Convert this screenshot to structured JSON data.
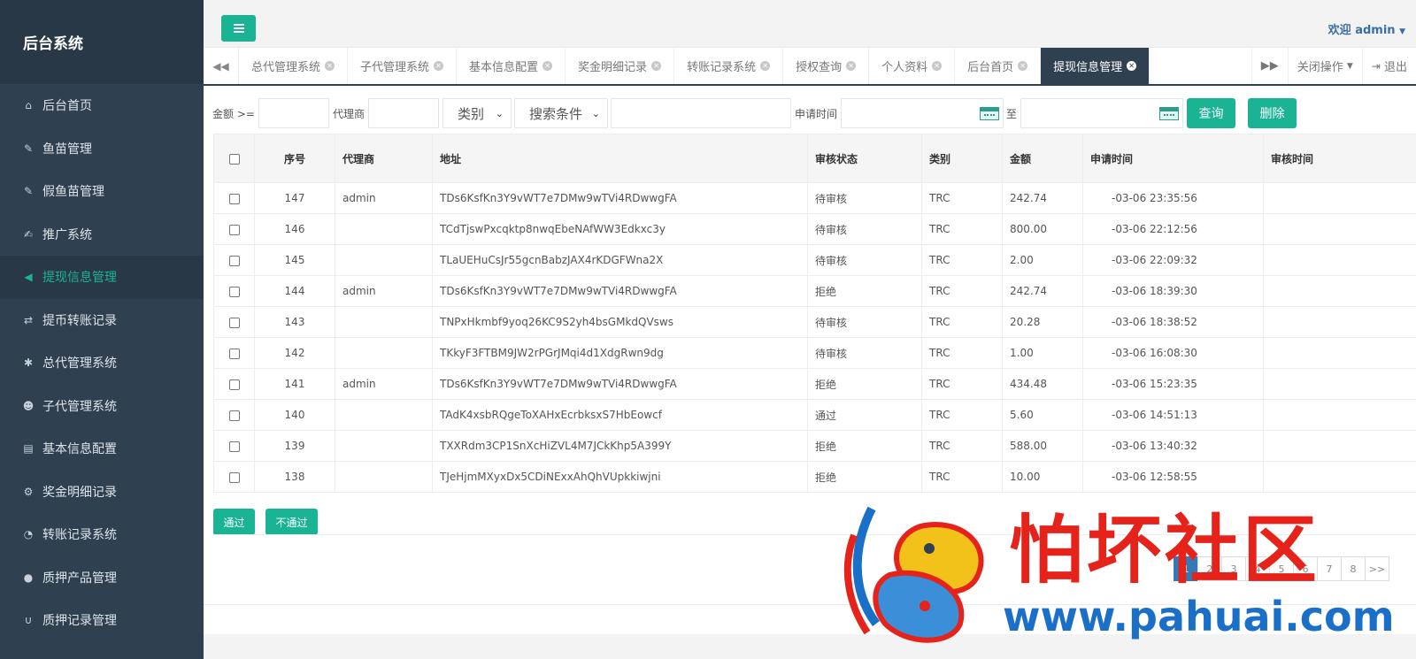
{
  "sidebar": {
    "brand": "后台系统",
    "items": [
      {
        "label": "后台首页",
        "icon": "home-icon",
        "glyph": "⌂",
        "active": false
      },
      {
        "label": "鱼苗管理",
        "icon": "wrench-icon",
        "glyph": "✎",
        "active": false
      },
      {
        "label": "假鱼苗管理",
        "icon": "wrench-icon",
        "glyph": "✎",
        "active": false
      },
      {
        "label": "推广系统",
        "icon": "edit-icon",
        "glyph": "✍",
        "active": false
      },
      {
        "label": "提现信息管理",
        "icon": "bullhorn-icon",
        "glyph": "◀",
        "active": true
      },
      {
        "label": "提币转账记录",
        "icon": "shuffle-icon",
        "glyph": "⇄",
        "active": false
      },
      {
        "label": "总代管理系统",
        "icon": "asterisk-icon",
        "glyph": "✱",
        "active": false
      },
      {
        "label": "子代管理系统",
        "icon": "users-icon",
        "glyph": "☻",
        "active": false
      },
      {
        "label": "基本信息配置",
        "icon": "file-icon",
        "glyph": "▤",
        "active": false
      },
      {
        "label": "奖金明细记录",
        "icon": "cogs-icon",
        "glyph": "⚙",
        "active": false
      },
      {
        "label": "转账记录系统",
        "icon": "dashboard-icon",
        "glyph": "◔",
        "active": false
      },
      {
        "label": "质押产品管理",
        "icon": "comment-icon",
        "glyph": "●",
        "active": false
      },
      {
        "label": "质押记录管理",
        "icon": "magnet-icon",
        "glyph": "∪",
        "active": false
      }
    ]
  },
  "header": {
    "welcome": "欢迎 admin"
  },
  "tabs": {
    "items": [
      {
        "label": "总代管理系统",
        "active": false
      },
      {
        "label": "子代管理系统",
        "active": false
      },
      {
        "label": "基本信息配置",
        "active": false
      },
      {
        "label": "奖金明细记录",
        "active": false
      },
      {
        "label": "转账记录系统",
        "active": false
      },
      {
        "label": "授权查询",
        "active": false
      },
      {
        "label": "个人资料",
        "active": false
      },
      {
        "label": "后台首页",
        "active": false
      },
      {
        "label": "提现信息管理",
        "active": true
      }
    ],
    "close_ops": "关闭操作",
    "logout": "退出"
  },
  "filters": {
    "amount_label": "金额 >=",
    "agent_label": "代理商",
    "category_select": "类别",
    "search_select": "搜索条件",
    "apply_time_label": "申请时间",
    "to_label": "至",
    "query_button": "查询",
    "delete_button": "删除"
  },
  "table": {
    "headers": [
      "序号",
      "代理商",
      "地址",
      "审核状态",
      "类别",
      "金额",
      "申请时间",
      "审核时间"
    ],
    "rows": [
      {
        "id": "147",
        "agent": "admin",
        "address": "TDs6KsfKn3Y9vWT7e7DMw9wTVi4RDwwgFA",
        "status": "待审核",
        "type": "TRC",
        "amount": "242.74",
        "time": "-03-06 23:35:56",
        "review": ""
      },
      {
        "id": "146",
        "agent": "",
        "address": "TCdTjswPxcqktp8nwqEbeNAfWW3Edkxc3y",
        "status": "待审核",
        "type": "TRC",
        "amount": "800.00",
        "time": "-03-06 22:12:56",
        "review": ""
      },
      {
        "id": "145",
        "agent": "",
        "address": "TLaUEHuCsJr55gcnBabzJAX4rKDGFWna2X",
        "status": "待审核",
        "type": "TRC",
        "amount": "2.00",
        "time": "-03-06 22:09:32",
        "review": ""
      },
      {
        "id": "144",
        "agent": "admin",
        "address": "TDs6KsfKn3Y9vWT7e7DMw9wTVi4RDwwgFA",
        "status": "拒绝",
        "type": "TRC",
        "amount": "242.74",
        "time": "-03-06 18:39:30",
        "review": ""
      },
      {
        "id": "143",
        "agent": "",
        "address": "TNPxHkmbf9yoq26KC9S2yh4bsGMkdQVsws",
        "status": "待审核",
        "type": "TRC",
        "amount": "20.28",
        "time": "-03-06 18:38:52",
        "review": ""
      },
      {
        "id": "142",
        "agent": "",
        "address": "TKkyF3FTBM9JW2rPGrJMqi4d1XdgRwn9dg",
        "status": "待审核",
        "type": "TRC",
        "amount": "1.00",
        "time": "-03-06 16:08:30",
        "review": ""
      },
      {
        "id": "141",
        "agent": "admin",
        "address": "TDs6KsfKn3Y9vWT7e7DMw9wTVi4RDwwgFA",
        "status": "拒绝",
        "type": "TRC",
        "amount": "434.48",
        "time": "-03-06 15:23:35",
        "review": ""
      },
      {
        "id": "140",
        "agent": "",
        "address": "TAdK4xsbRQgeToXAHxEcrbksxS7HbEowcf",
        "status": "通过",
        "type": "TRC",
        "amount": "5.60",
        "time": "-03-06 14:51:13",
        "review": ""
      },
      {
        "id": "139",
        "agent": "",
        "address": "TXXRdm3CP1SnXcHiZVL4M7JCkKhp5A399Y",
        "status": "拒绝",
        "type": "TRC",
        "amount": "588.00",
        "time": "-03-06 13:40:32",
        "review": ""
      },
      {
        "id": "138",
        "agent": "",
        "address": "TJeHjmMXyxDx5CDiNExxAhQhVUpkkiwjni",
        "status": "拒绝",
        "type": "TRC",
        "amount": "10.00",
        "time": "-03-06 12:58:55",
        "review": ""
      }
    ]
  },
  "actions": {
    "approve": "通过",
    "reject": "不通过"
  },
  "pager": {
    "pages": [
      "1",
      "2",
      "3",
      "4",
      "5",
      "6",
      "7",
      "8"
    ],
    "next": ">>"
  },
  "watermark": {
    "title": "怕坏社区",
    "url": "www.pahuai.com"
  },
  "colors": {
    "sidebar_bg": "#2f4050",
    "accent": "#1ab394",
    "link_blue": "#3a6ea5",
    "watermark_red": "#e5231b",
    "watermark_blue": "#1a6fc8"
  }
}
